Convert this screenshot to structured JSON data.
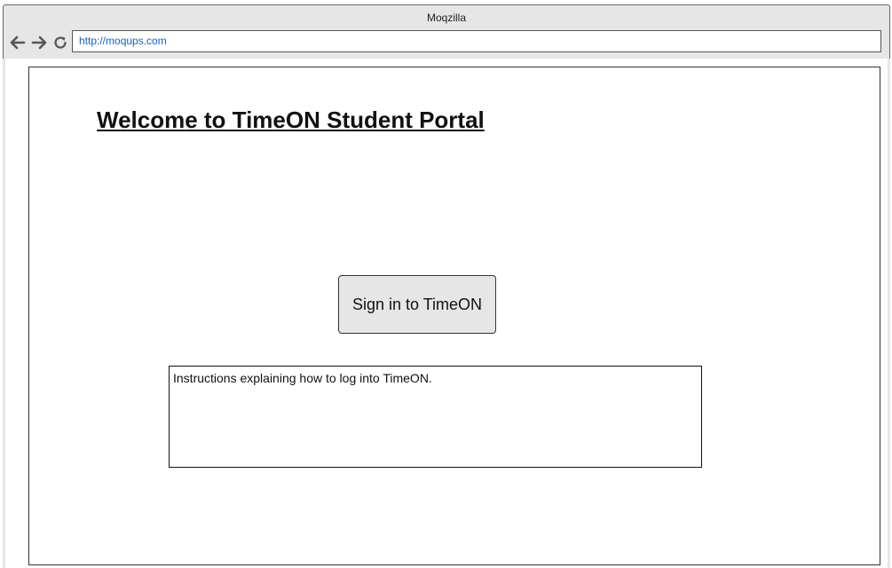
{
  "browser": {
    "window_title": "Moqzilla",
    "url": "http://moqups.com",
    "icons": [
      "back-arrow-icon",
      "forward-arrow-icon",
      "reload-icon"
    ]
  },
  "page": {
    "title": "Welcome to TimeON Student Portal",
    "signin_button_label": "Sign in to TimeON",
    "instructions_text": "Instructions explaining how to log into TimeON."
  },
  "colors": {
    "chrome_bg": "#e6e6e6",
    "url_text": "#1c5fbf",
    "button_bg": "#e6e6e6"
  }
}
